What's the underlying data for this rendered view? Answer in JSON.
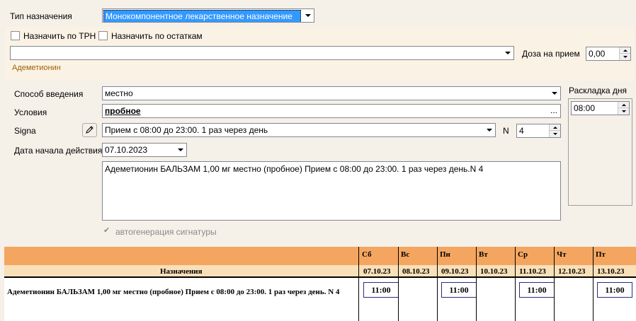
{
  "form": {
    "type_label": "Тип назначения",
    "type_value": "Монокомпонентное лекарственное назначение",
    "assign_trn_label": "Назначить по ТРН",
    "assign_stock_label": "Назначить по остаткам",
    "drug_value": "",
    "dose_label": "Доза на прием",
    "dose_value": "0,00",
    "drug_name": "Адеметионин",
    "route_label": "Способ введения",
    "route_value": "местно",
    "conditions_label": "Условия",
    "conditions_value": "пробное",
    "conditions_btn": "...",
    "signa_label": "Signa",
    "signa_value": "Прием с 08:00 до 23:00. 1 раз через день",
    "n_label": "N",
    "n_value": "4",
    "start_label": "Дата начала действия",
    "start_value": "07.10.2023",
    "summary_text": "Адеметионин БАЛЬЗАМ 1,00 мг  местно (пробное)   Прием с 08:00 до 23:00. 1 раз через день.N 4",
    "autogen_label": "автогенерация сигнатуры",
    "layout_label": "Раскладка дня",
    "layout_time": "08:00"
  },
  "schedule": {
    "col_header": "Назначения",
    "row_text": "Адеметионин БАЛЬЗАМ 1,00 мг  местно (пробное)  Прием с 08:00 до 23:00. 1 раз через день. N 4",
    "days": [
      {
        "dow": "Сб",
        "date": "07.10.23",
        "time": "11:00"
      },
      {
        "dow": "Вс",
        "date": "08.10.23",
        "time": ""
      },
      {
        "dow": "Пн",
        "date": "09.10.23",
        "time": "11:00"
      },
      {
        "dow": "Вт",
        "date": "10.10.23",
        "time": ""
      },
      {
        "dow": "Ср",
        "date": "11.10.23",
        "time": "11:00"
      },
      {
        "dow": "Чт",
        "date": "12.10.23",
        "time": ""
      },
      {
        "dow": "Пт",
        "date": "13.10.23",
        "time": "11:00"
      }
    ]
  }
}
